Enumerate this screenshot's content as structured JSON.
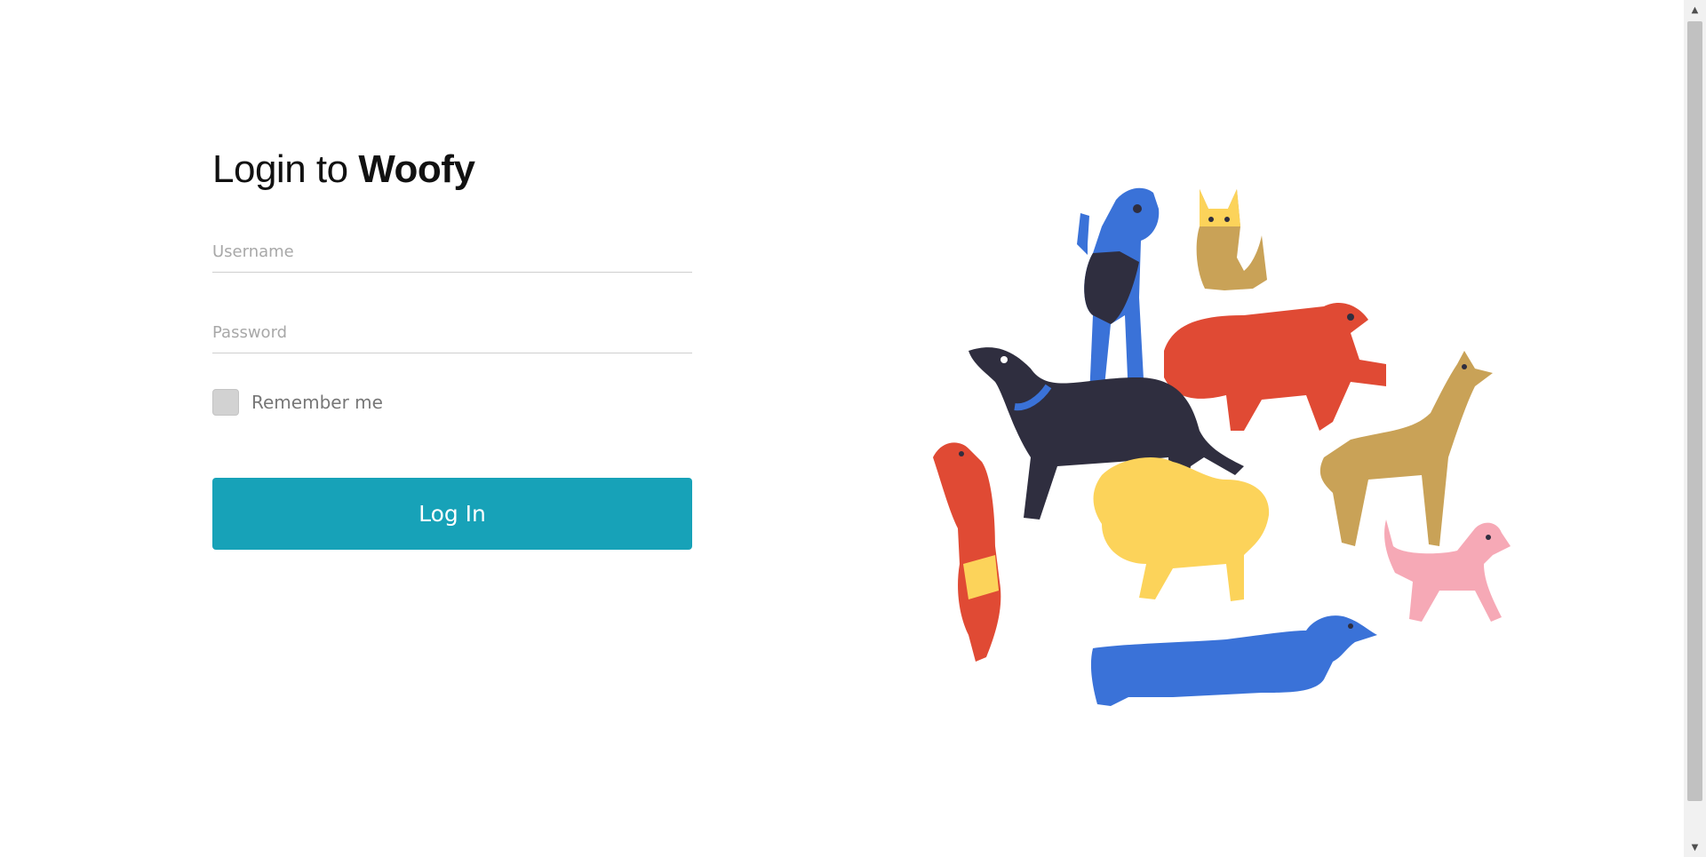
{
  "login": {
    "title_prefix": "Login to ",
    "brand": "Woofy",
    "username_placeholder": "Username",
    "password_placeholder": "Password",
    "remember_label": "Remember me",
    "login_button": "Log In",
    "accent_color": "#17a2b8"
  },
  "illustration": {
    "subject": "group of stylized dogs",
    "colors": [
      "#3a72d8",
      "#e04a34",
      "#fcd35a",
      "#c9a257",
      "#2f2e3f",
      "#f6a9b6"
    ]
  },
  "scrollbar": {
    "up_icon": "▲",
    "down_icon": "▼"
  }
}
